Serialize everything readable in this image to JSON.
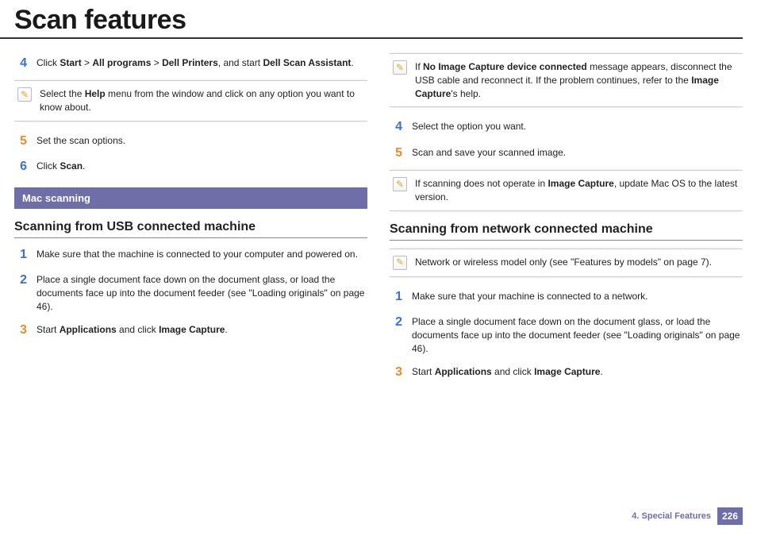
{
  "title": "Scan features",
  "left": {
    "step4": {
      "num": "4",
      "pre": "Click ",
      "b1": "Start",
      "sep1": " > ",
      "b2": "All programs",
      "sep2": " > ",
      "b3": "Dell Printers",
      "mid": ", and start ",
      "b4": "Dell Scan Assistant",
      "post": "."
    },
    "note1": {
      "pre": "Select the ",
      "b1": "Help",
      "post": " menu from the window and click on any option you want to know about."
    },
    "step5": {
      "num": "5",
      "txt": "Set the scan options."
    },
    "step6": {
      "num": "6",
      "pre": "Click ",
      "b1": "Scan",
      "post": "."
    },
    "section": "Mac scanning",
    "subheading": "Scanning from USB connected machine",
    "usb1": {
      "num": "1",
      "txt": "Make sure that the machine is connected to your computer and powered on."
    },
    "usb2": {
      "num": "2",
      "txt": "Place a single document face down on the document glass, or load the documents face up into the document feeder (see \"Loading originals\" on page 46)."
    },
    "usb3": {
      "num": "3",
      "pre": "Start ",
      "b1": "Applications",
      "mid": " and click ",
      "b2": "Image Capture",
      "post": "."
    }
  },
  "right": {
    "note1": {
      "pre": "If ",
      "b1": "No Image Capture device connected",
      "mid": " message appears, disconnect the USB cable and reconnect it. If the problem continues, refer to the ",
      "b2": "Image Capture",
      "post": "'s help."
    },
    "step4": {
      "num": "4",
      "txt": "Select the option you want."
    },
    "step5": {
      "num": "5",
      "txt": "Scan and save your scanned image."
    },
    "note2": {
      "pre": "If scanning does not operate in ",
      "b1": "Image Capture",
      "post": ", update Mac OS to the latest version."
    },
    "subheading": "Scanning from network connected machine",
    "note3": {
      "txt": "Network or wireless model only (see \"Features by models\" on page 7)."
    },
    "net1": {
      "num": "1",
      "txt": "Make sure that your machine is connected to a network."
    },
    "net2": {
      "num": "2",
      "txt": "Place a single document face down on the document glass, or load the documents face up into the document feeder (see \"Loading originals\" on page 46)."
    },
    "net3": {
      "num": "3",
      "pre": "Start ",
      "b1": "Applications",
      "mid": " and click ",
      "b2": "Image Capture",
      "post": "."
    }
  },
  "footer": {
    "chapter": "4.  Special Features",
    "page": "226"
  },
  "icons": {
    "pencil": "✎"
  }
}
